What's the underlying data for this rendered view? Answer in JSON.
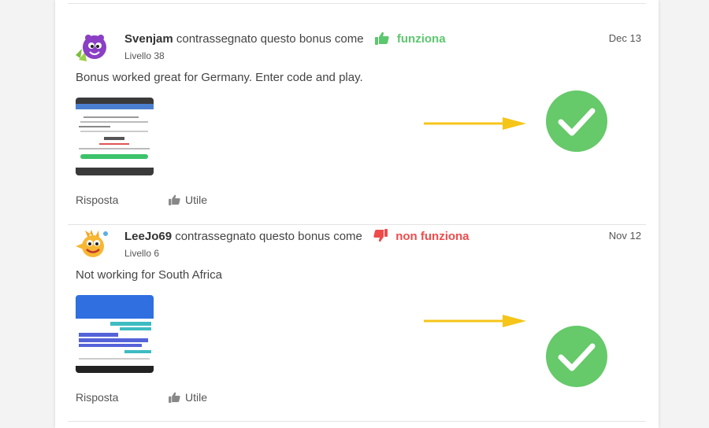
{
  "colors": {
    "works_green": "#5cc86e",
    "not_works_red": "#f04b4b",
    "arrow_yellow": "#f5c518",
    "check_green": "#66c96a"
  },
  "reviews": [
    {
      "username": "Svenjam",
      "action_text": "contrassegnato questo bonus come",
      "verdict": "funziona",
      "verdict_icon": "thumbs-up-icon",
      "level": "Livello 38",
      "date": "Dec 13",
      "comment": "Bonus worked great for Germany. Enter code and play.",
      "reply_label": "Risposta",
      "useful_label": "Utile"
    },
    {
      "username": "LeeJo69",
      "action_text": "contrassegnato questo bonus come",
      "verdict": "non funziona",
      "verdict_icon": "thumbs-down-icon",
      "level": "Livello 6",
      "date": "Nov 12",
      "comment": "Not working for South Africa",
      "reply_label": "Risposta",
      "useful_label": "Utile"
    }
  ]
}
